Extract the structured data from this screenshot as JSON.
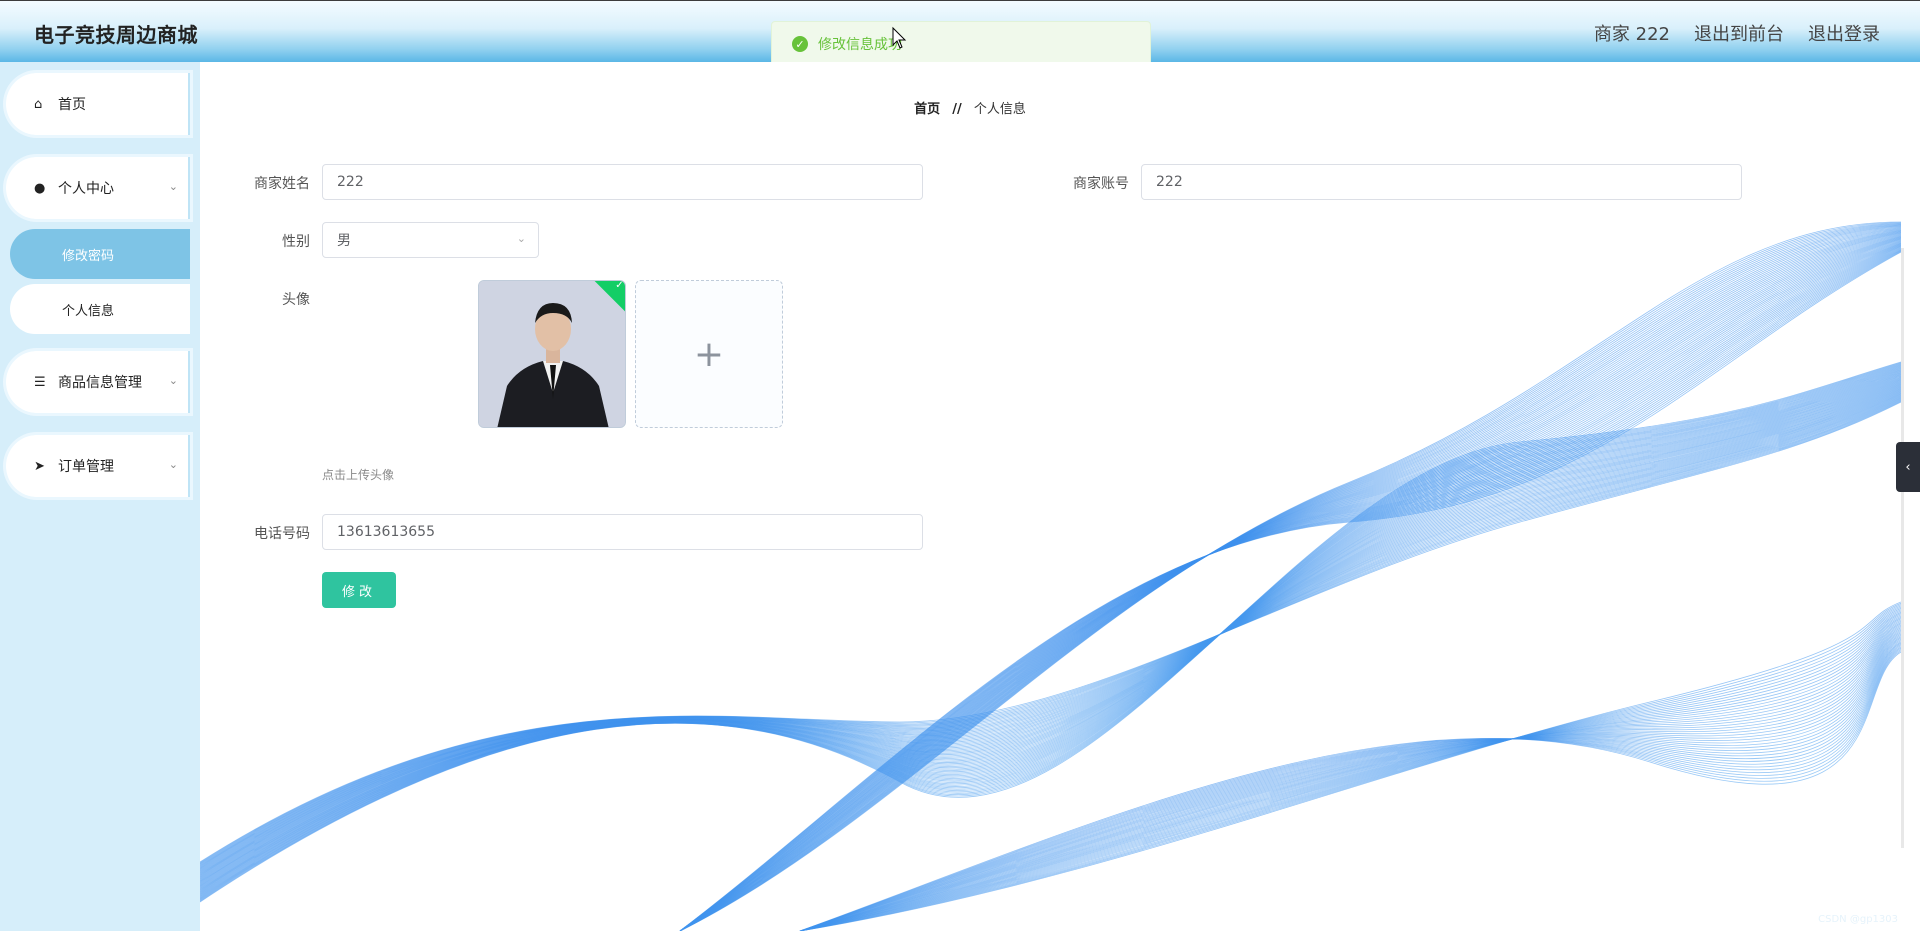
{
  "header": {
    "brand": "电子竞技周边商城",
    "user_label": "商家 222",
    "to_front": "退出到前台",
    "logout": "退出登录"
  },
  "toast": {
    "message": "修改信息成功"
  },
  "sidebar": {
    "items": [
      {
        "label": "首页",
        "icon": "home-icon"
      },
      {
        "label": "个人中心",
        "icon": "user-icon"
      },
      {
        "label": "修改密码"
      },
      {
        "label": "个人信息"
      },
      {
        "label": "商品信息管理",
        "icon": "list-icon"
      },
      {
        "label": "订单管理",
        "icon": "send-icon"
      }
    ]
  },
  "breadcrumb": {
    "home": "首页",
    "separator": "//",
    "current": "个人信息"
  },
  "form": {
    "merchant_name_label": "商家姓名",
    "merchant_name_value": "222",
    "merchant_account_label": "商家账号",
    "merchant_account_value": "222",
    "gender_label": "性别",
    "gender_value": "男",
    "avatar_label": "头像",
    "avatar_tip": "点击上传头像",
    "phone_label": "电话号码",
    "phone_value": "13613613655",
    "submit_label": "修改"
  },
  "watermark": "CSDN @gp1303",
  "colors": {
    "primary_button": "#2fc49f",
    "active_menu": "#7ec4e6",
    "sidebar_bg": "#d6eefa",
    "toast_text": "#67c23a"
  }
}
